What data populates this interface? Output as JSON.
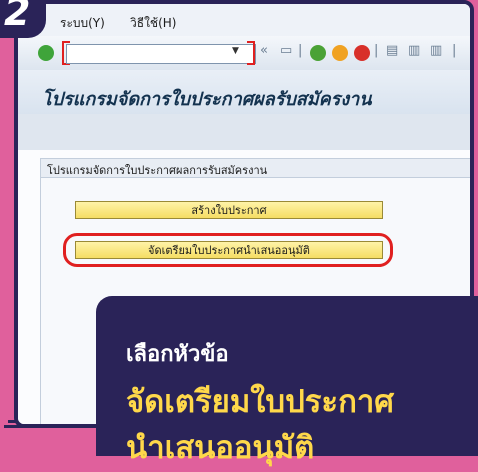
{
  "step": {
    "number": "2"
  },
  "menubar": {
    "items": [
      {
        "label": "ระบบ(Y)"
      },
      {
        "label": "วิธีใช้(H)"
      }
    ]
  },
  "toolbar": {
    "command_value": ""
  },
  "title": "โปรแกรมจัดการใบประกาศผลรับสมัครงาน",
  "group": {
    "title": "โปรแกรมจัดการใบประกาศผลการรับสมัครงาน",
    "buttons": [
      {
        "label": "สร้างใบประกาศ"
      },
      {
        "label": "จัดเตรียมใบประกาศนำเสนออนุมัติ"
      }
    ]
  },
  "callout": {
    "line1": "เลือกหัวข้อ",
    "line2": "จัดเตรียมใบประกาศ",
    "line3": "นำเสนออนุมัติ"
  },
  "colors": {
    "background": "#e0609c",
    "navy": "#2a2358",
    "highlight": "#e02020",
    "callout_text": "#ffd84a"
  }
}
